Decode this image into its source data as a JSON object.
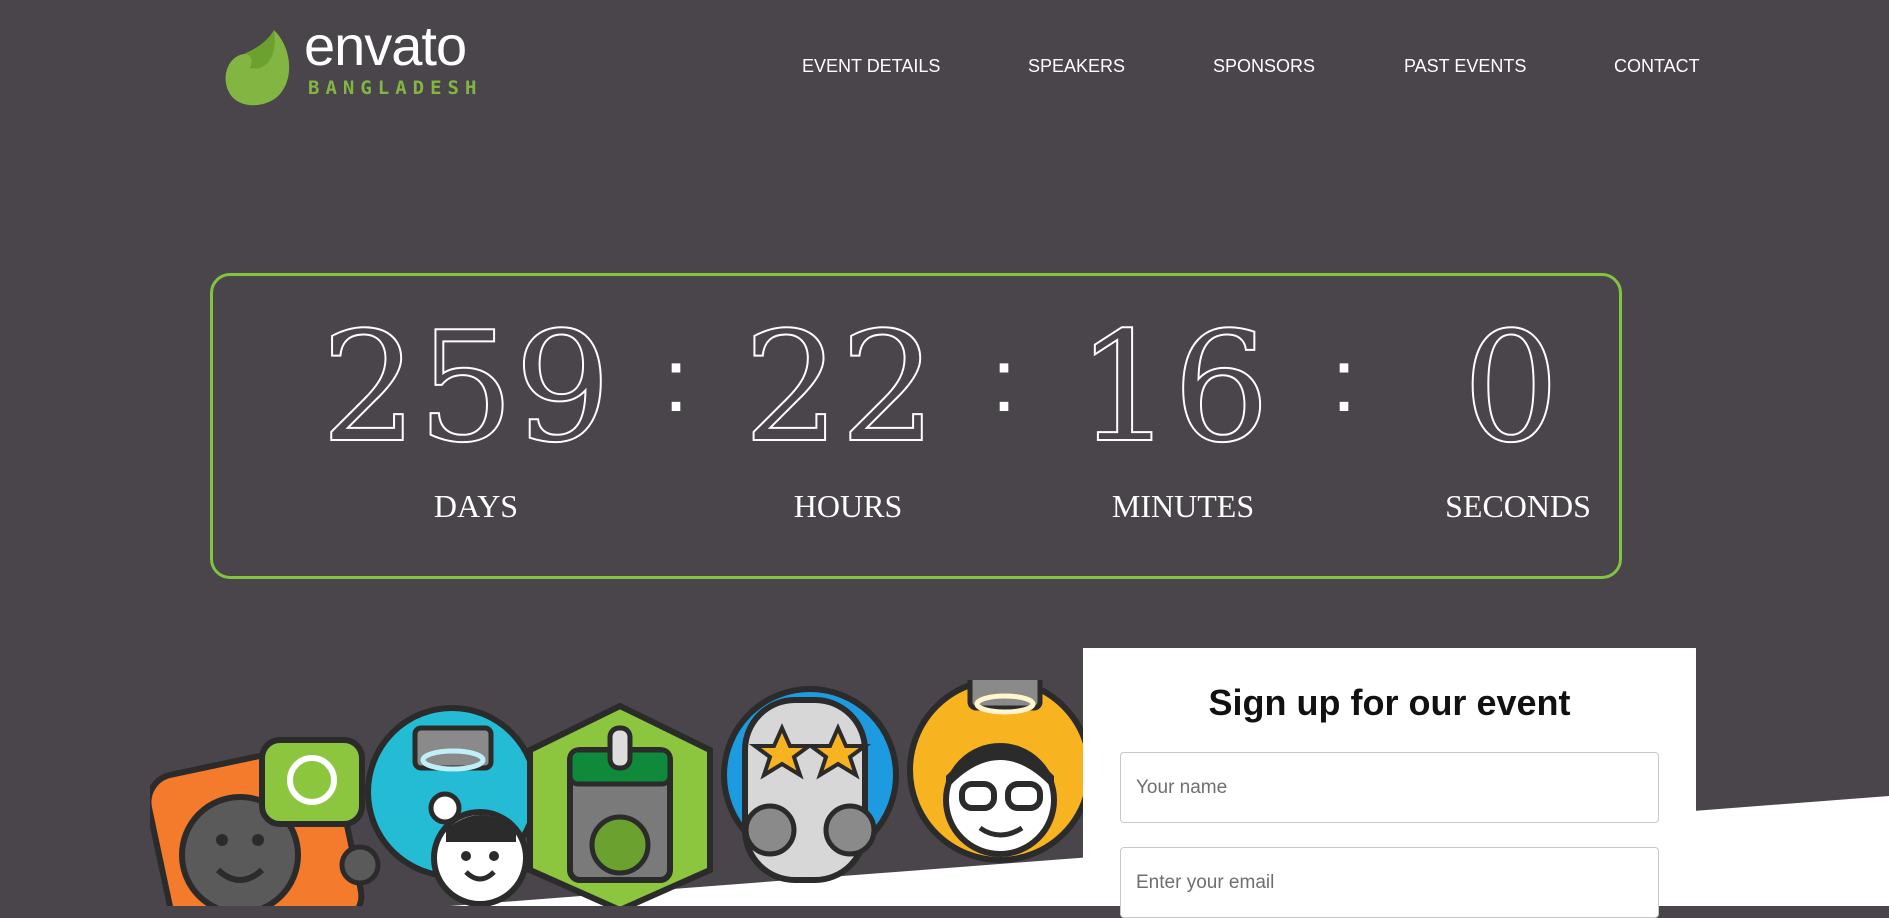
{
  "brand": {
    "name": "envato",
    "subtitle": "BANGLADESH",
    "colors": {
      "accent": "#82b541",
      "leaf_dark": "#6aa12f",
      "background": "#4a444b"
    }
  },
  "nav": {
    "items": [
      {
        "label": "EVENT DETAILS"
      },
      {
        "label": "SPEAKERS"
      },
      {
        "label": "SPONSORS"
      },
      {
        "label": "PAST EVENTS"
      },
      {
        "label": "CONTACT"
      }
    ]
  },
  "countdown": {
    "border_color": "#82c341",
    "separator": ":",
    "units": [
      {
        "value": "259",
        "label": "DAYS"
      },
      {
        "value": "22",
        "label": "HOURS"
      },
      {
        "value": "16",
        "label": "MINUTES"
      },
      {
        "value": "0",
        "label": "SECONDS"
      }
    ]
  },
  "mascots": {
    "icons": [
      "lightbulb-mascot-icon",
      "halo-mascot-icon",
      "envato-badge-icon",
      "star-eyes-mascot-icon",
      "glasses-mascot-icon"
    ],
    "colors": [
      "#f47b2b",
      "#23bcd4",
      "#8cc63f",
      "#1e9be0",
      "#f7b320"
    ]
  },
  "signup": {
    "title": "Sign up for our event",
    "name_placeholder": "Your name",
    "email_placeholder": "Enter your email"
  }
}
